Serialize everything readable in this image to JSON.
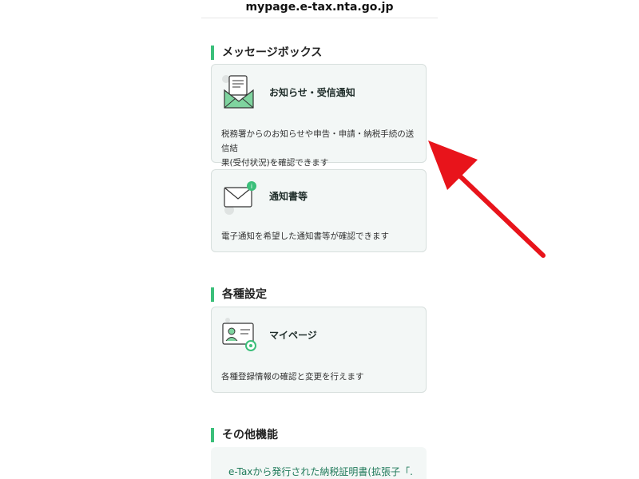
{
  "browser": {
    "url": "mypage.e-tax.nta.go.jp"
  },
  "sections": [
    {
      "heading": "メッセージボックス",
      "cards": [
        {
          "title": "お知らせ・受信通知",
          "desc_line1": "税務署からのお知らせや申告・申請・納税手続の送信結",
          "desc_line2": "果(受付状況)を確認できます",
          "icon": "envelope-document-icon"
        },
        {
          "title": "通知書等",
          "desc_line1": "電子通知を希望した通知書等が確認できます",
          "icon": "envelope-info-icon"
        }
      ]
    },
    {
      "heading": "各種設定",
      "cards": [
        {
          "title": "マイページ",
          "desc_line1": "各種登録情報の確認と変更を行えます",
          "icon": "profile-card-gear-icon"
        }
      ]
    },
    {
      "heading": "その他機能",
      "link": "e-Taxから発行された納税証明書(拡張子「."
    }
  ],
  "colors": {
    "accent": "#3bbf7a",
    "arrow": "#e8141b",
    "card_bg": "#f3f7f6"
  }
}
